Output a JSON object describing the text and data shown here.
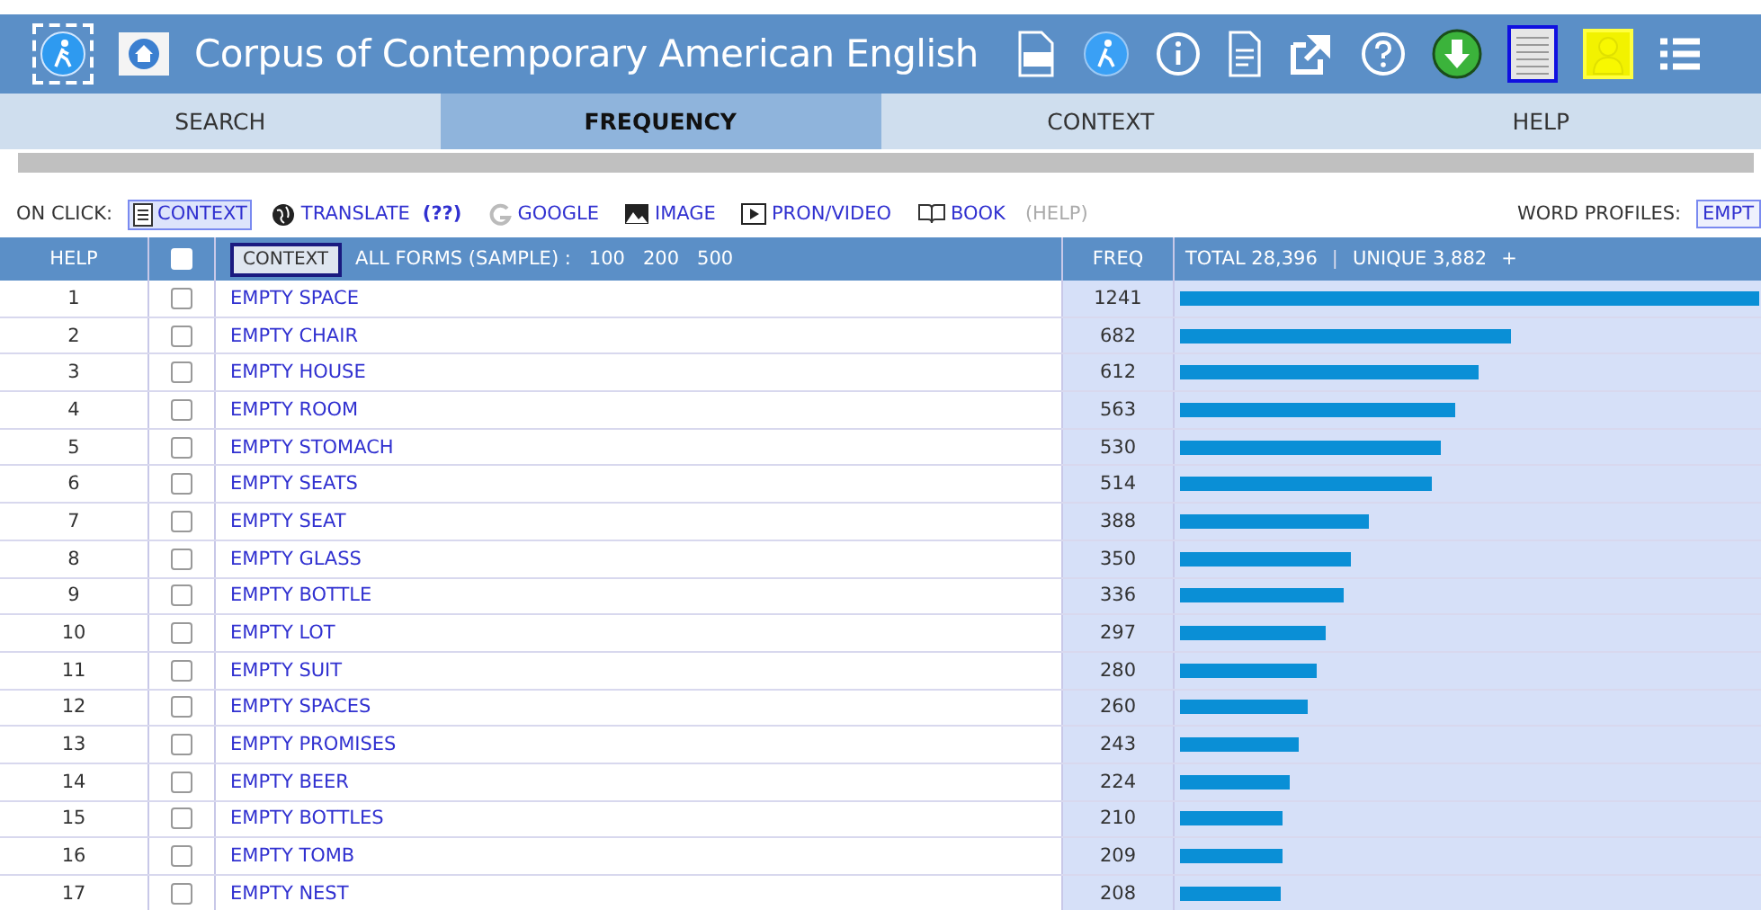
{
  "header": {
    "title": "Corpus of Contemporary American English"
  },
  "tabs": [
    {
      "label": "SEARCH",
      "selected": false
    },
    {
      "label": "FREQUENCY",
      "selected": true
    },
    {
      "label": "CONTEXT",
      "selected": false
    },
    {
      "label": "HELP",
      "selected": false
    }
  ],
  "on_click": {
    "label": "ON CLICK:",
    "options": [
      {
        "kind": "context",
        "label": "CONTEXT",
        "selected": true
      },
      {
        "kind": "translate",
        "label": "TRANSLATE",
        "extra": "(??)",
        "selected": false
      },
      {
        "kind": "google",
        "label": "GOOGLE",
        "selected": false
      },
      {
        "kind": "image",
        "label": "IMAGE",
        "selected": false
      },
      {
        "kind": "video",
        "label": "PRON/VIDEO",
        "selected": false
      },
      {
        "kind": "book",
        "label": "BOOK",
        "selected": false
      }
    ],
    "help": "(HELP)",
    "profiles_label": "WORD PROFILES:",
    "profiles_value": "EMPT"
  },
  "table": {
    "help": "HELP",
    "checked": false,
    "context_button": "CONTEXT",
    "forms_label": "ALL FORMS (SAMPLE) :",
    "samples": [
      "100",
      "200",
      "500"
    ],
    "freq": "FREQ",
    "total": "TOTAL 28,396",
    "separator": "|",
    "unique": "UNIQUE 3,882",
    "plus": "+",
    "rows": [
      {
        "n": "1",
        "word": "EMPTY SPACE",
        "freq": "1241",
        "checked": false,
        "level": 1.0
      },
      {
        "n": "2",
        "word": "EMPTY CHAIR",
        "freq": "682",
        "checked": false,
        "level": 0.57
      },
      {
        "n": "3",
        "word": "EMPTY HOUSE",
        "freq": "612",
        "checked": false,
        "level": 0.515
      },
      {
        "n": "4",
        "word": "EMPTY ROOM",
        "freq": "563",
        "checked": false,
        "level": 0.474
      },
      {
        "n": "5",
        "word": "EMPTY STOMACH",
        "freq": "530",
        "checked": false,
        "level": 0.45
      },
      {
        "n": "6",
        "word": "EMPTY SEATS",
        "freq": "514",
        "checked": false,
        "level": 0.435
      },
      {
        "n": "7",
        "word": "EMPTY SEAT",
        "freq": "388",
        "checked": false,
        "level": 0.327
      },
      {
        "n": "8",
        "word": "EMPTY GLASS",
        "freq": "350",
        "checked": false,
        "level": 0.295
      },
      {
        "n": "9",
        "word": "EMPTY BOTTLE",
        "freq": "336",
        "checked": false,
        "level": 0.283
      },
      {
        "n": "10",
        "word": "EMPTY LOT",
        "freq": "297",
        "checked": false,
        "level": 0.25
      },
      {
        "n": "11",
        "word": "EMPTY SUIT",
        "freq": "280",
        "checked": false,
        "level": 0.236
      },
      {
        "n": "12",
        "word": "EMPTY SPACES",
        "freq": "260",
        "checked": false,
        "level": 0.219
      },
      {
        "n": "13",
        "word": "EMPTY PROMISES",
        "freq": "243",
        "checked": false,
        "level": 0.205
      },
      {
        "n": "14",
        "word": "EMPTY BEER",
        "freq": "224",
        "checked": false,
        "level": 0.189
      },
      {
        "n": "15",
        "word": "EMPTY BOTTLES",
        "freq": "210",
        "checked": false,
        "level": 0.177
      },
      {
        "n": "16",
        "word": "EMPTY TOMB",
        "freq": "209",
        "checked": false,
        "level": 0.176
      },
      {
        "n": "17",
        "word": "EMPTY NEST",
        "freq": "208",
        "checked": false,
        "level": 0.175
      }
    ]
  }
}
